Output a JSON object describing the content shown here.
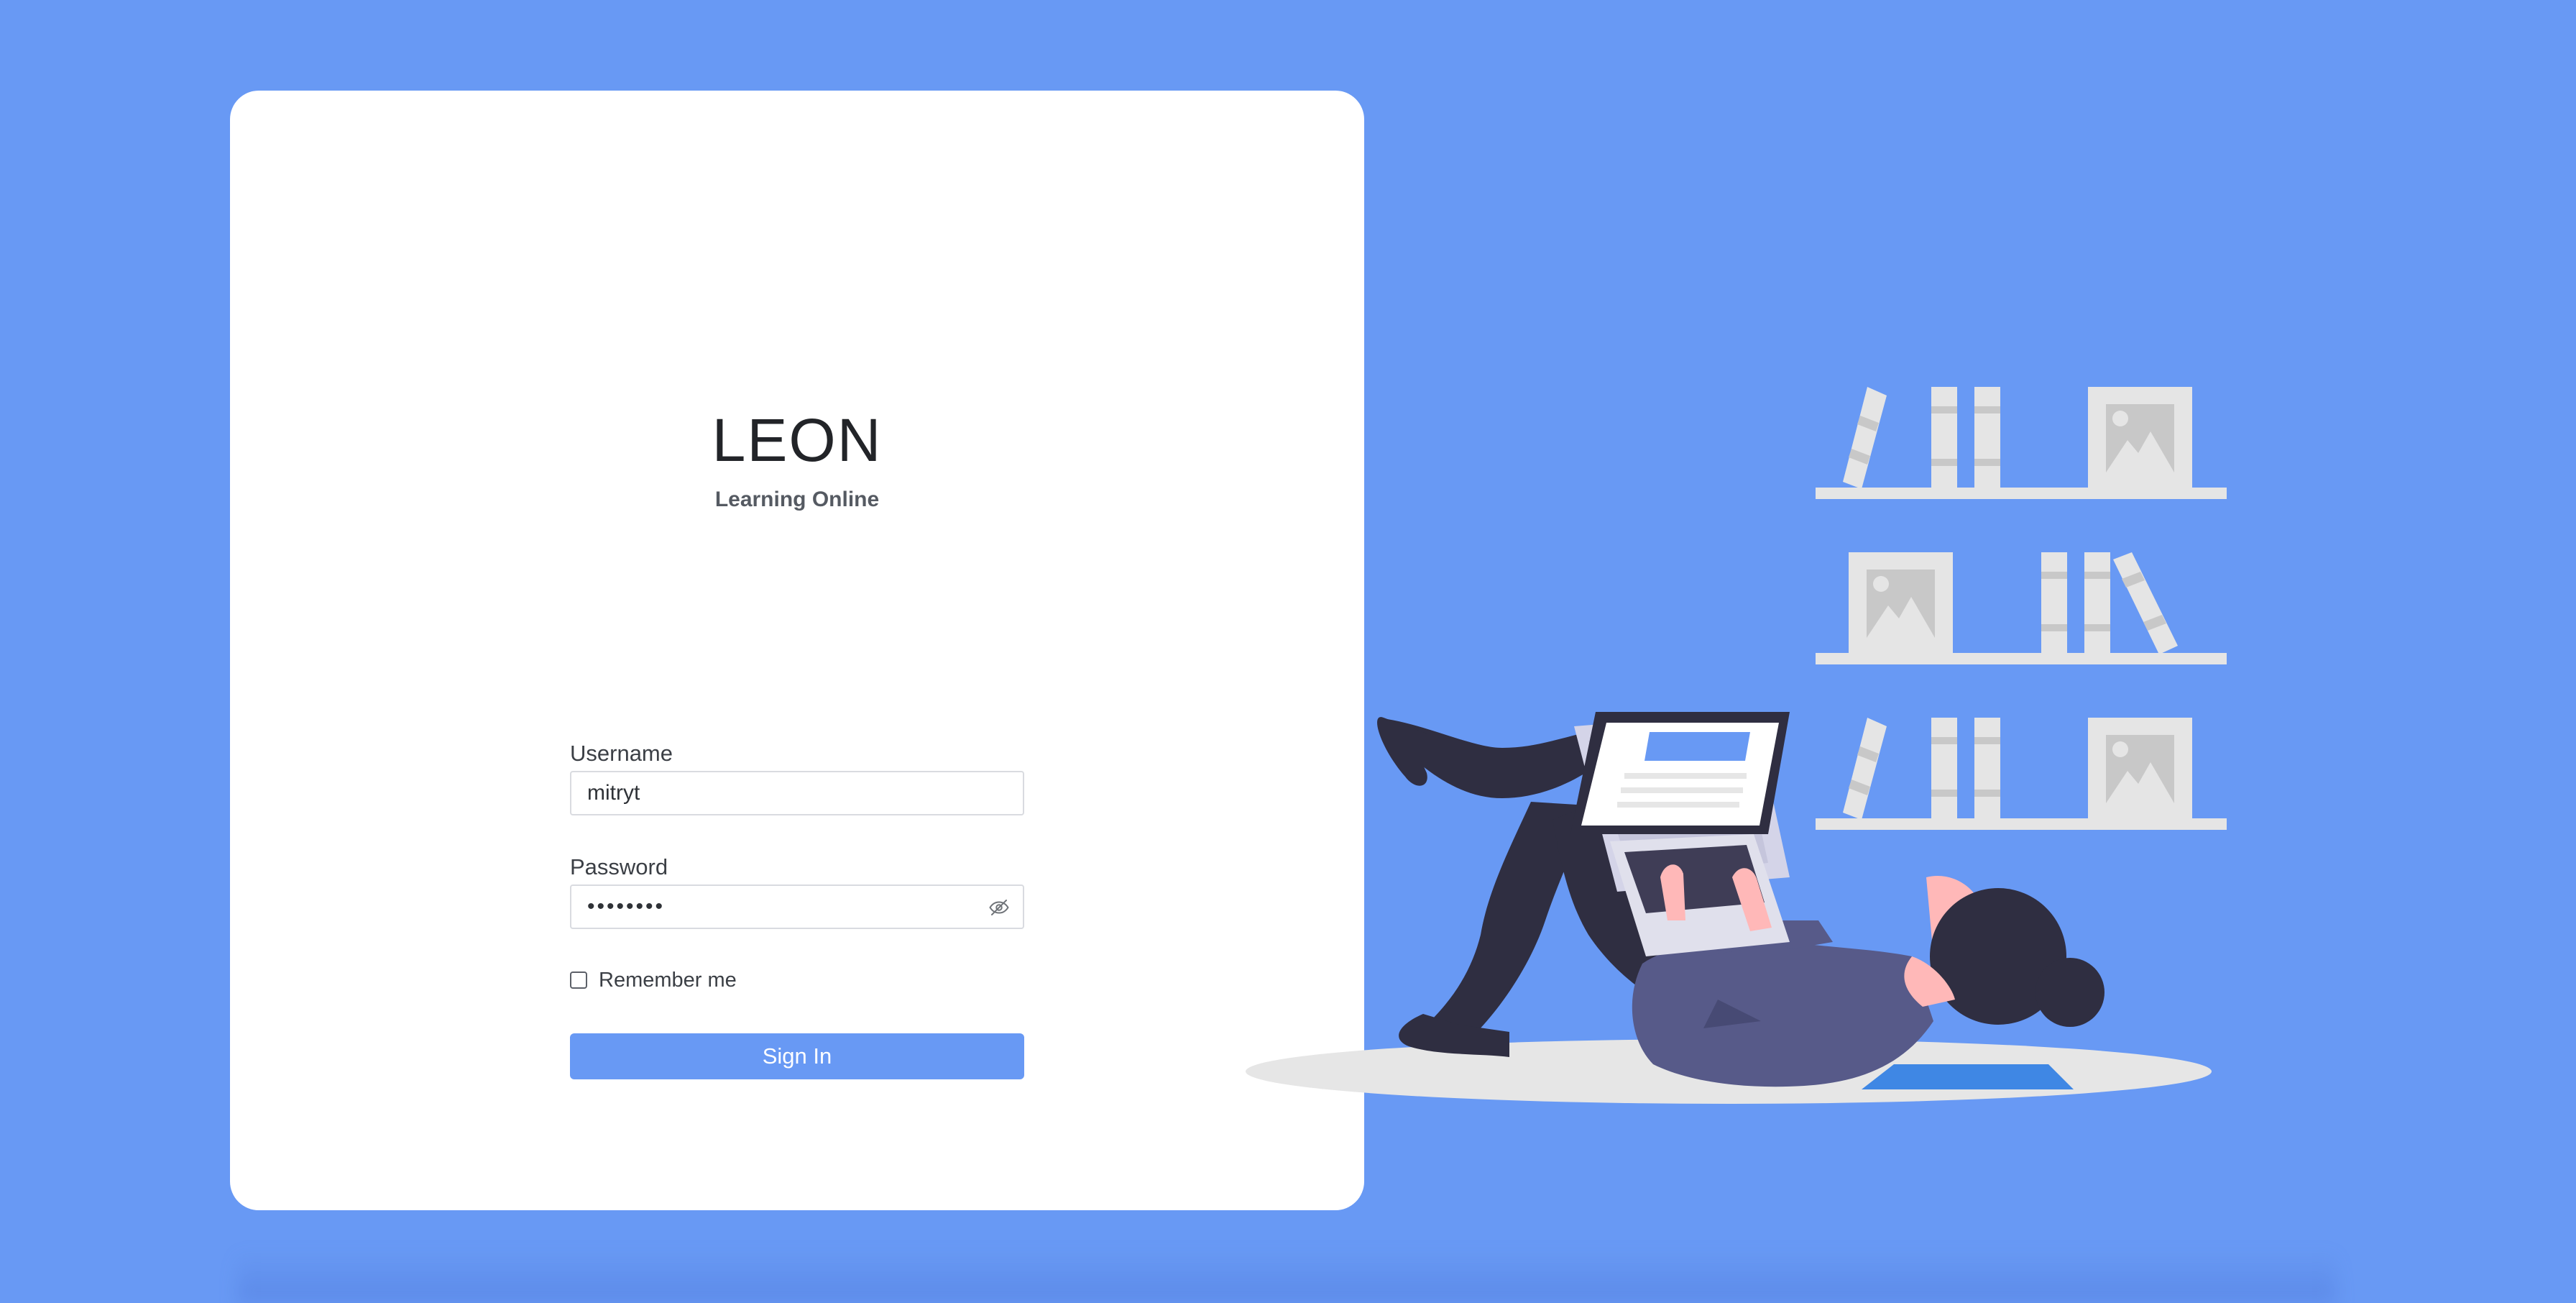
{
  "brand": {
    "title": "LEON",
    "subtitle": "Learning Online"
  },
  "form": {
    "username_label": "Username",
    "username_value": "mitryt",
    "password_label": "Password",
    "password_value": "••••••••",
    "password_mask": "••••••••",
    "remember_label": "Remember me",
    "remember_checked": false,
    "signin_label": "Sign In"
  },
  "icons": {
    "password_toggle": "eye-slash-icon",
    "illustration": "person-reading-laptop-with-bookshelves"
  },
  "colors": {
    "background": "#6899f4",
    "card": "#ffffff",
    "accent": "#6899f4",
    "title_text": "#222428",
    "muted_text": "#555a62",
    "illustration_shelf": "#e5e5e5",
    "illustration_figure_dark": "#2f2e41",
    "illustration_figure_shirt": "#575a89",
    "illustration_skin": "#ffb8b8"
  }
}
